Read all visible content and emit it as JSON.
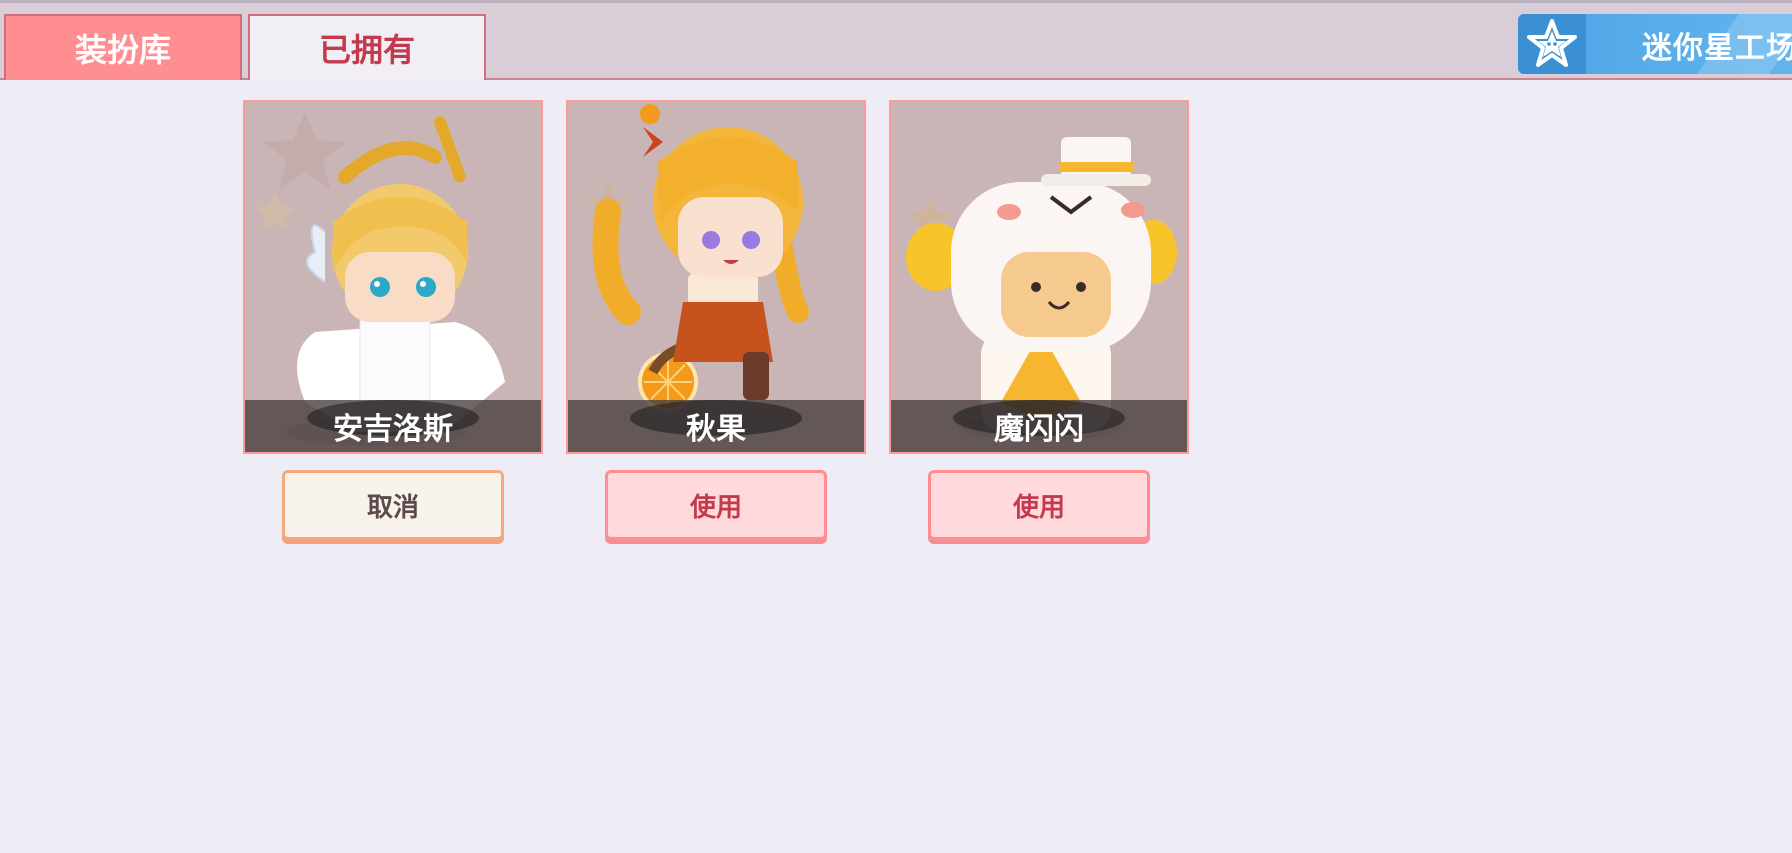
{
  "tabs": [
    {
      "label": "装扮库",
      "active": false
    },
    {
      "label": "已拥有",
      "active": true
    }
  ],
  "workshop": {
    "label": "迷你星工场",
    "icon": "star-icon"
  },
  "skins": [
    {
      "name": "安吉洛斯",
      "action": "取消"
    },
    {
      "name": "秋果",
      "action": "使用"
    },
    {
      "name": "魔闪闪",
      "action": "使用"
    }
  ],
  "colors": {
    "accent": "#ff8e93",
    "active_text": "#c33a4d",
    "workshop_blue": "#4ea3e5"
  }
}
